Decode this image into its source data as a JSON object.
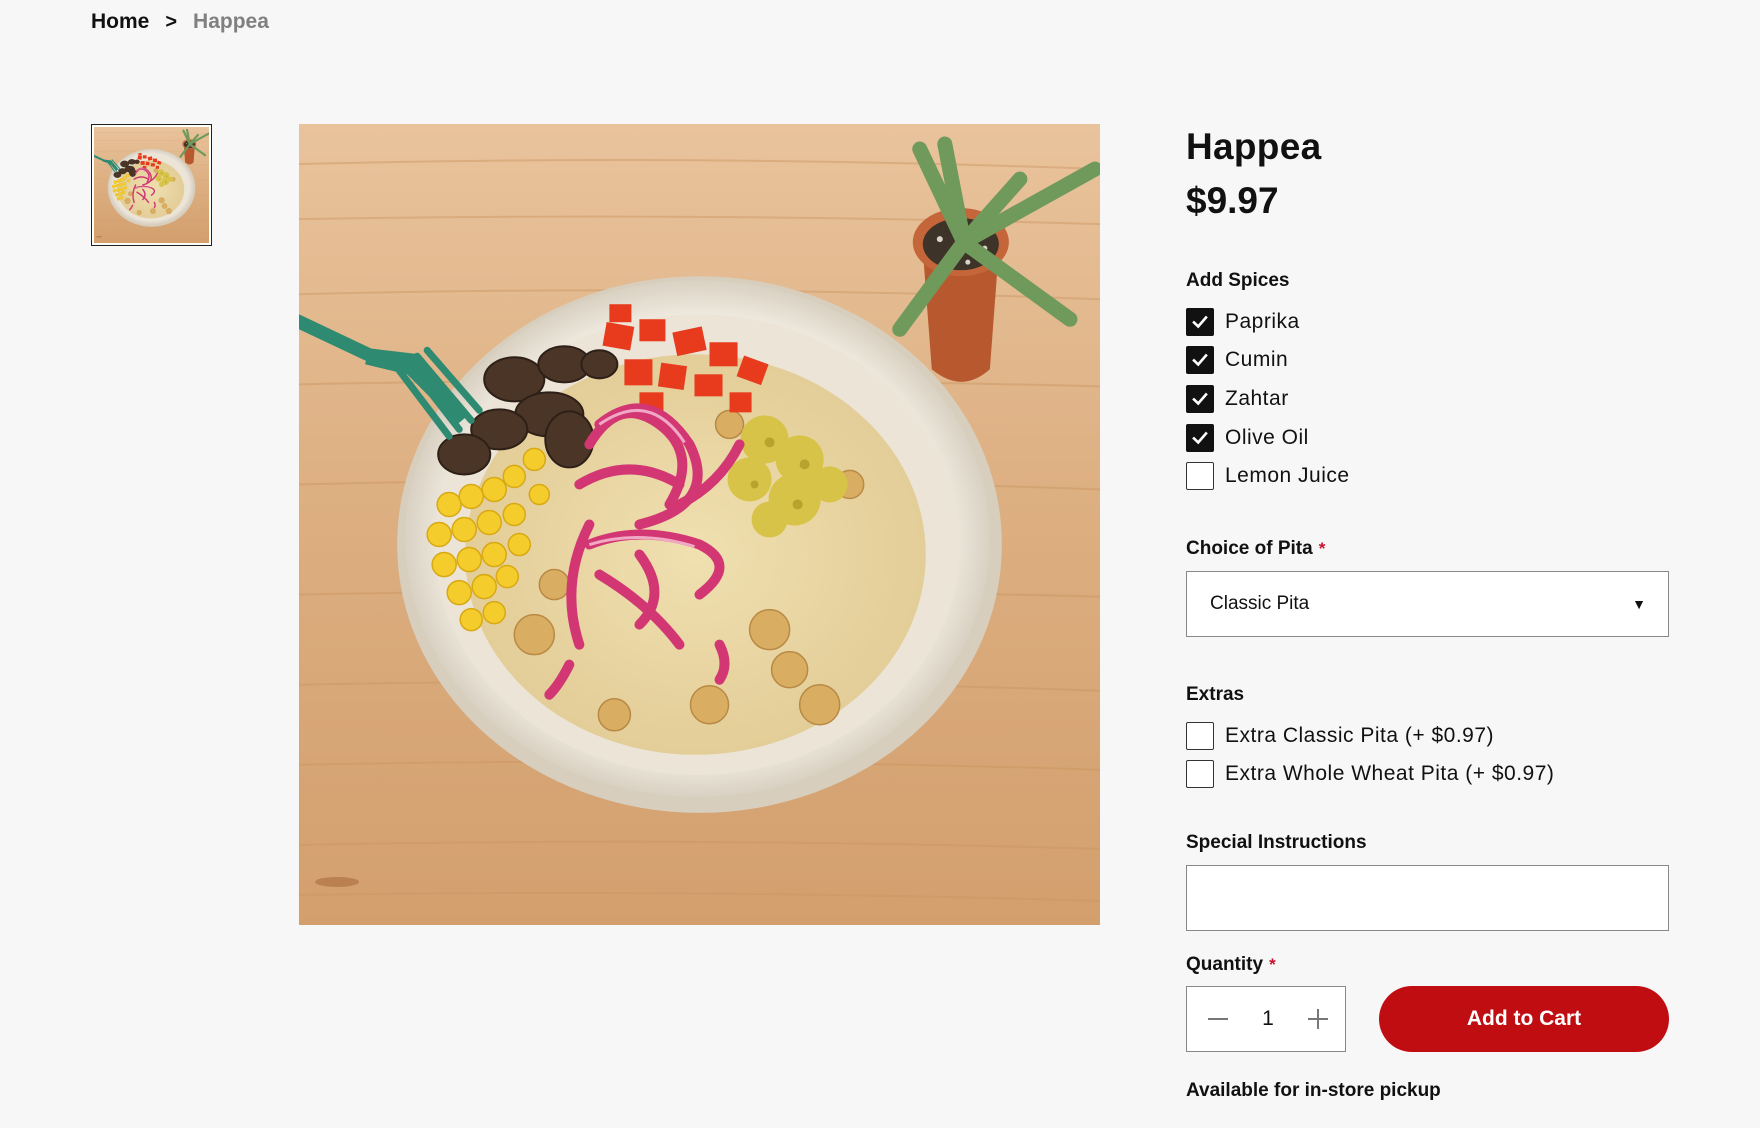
{
  "breadcrumb": {
    "home": "Home",
    "separator": ">",
    "current": "Happea"
  },
  "product": {
    "name": "Happea",
    "price": "$9.97",
    "image_subject": "hummus bowl with mushrooms, red peppers, corn, pickled onions, relish and chickpeas; green fork; potted succulent"
  },
  "spices": {
    "label": "Add Spices",
    "options": [
      {
        "label": "Paprika",
        "checked": true
      },
      {
        "label": "Cumin",
        "checked": true
      },
      {
        "label": "Zahtar",
        "checked": true
      },
      {
        "label": "Olive Oil",
        "checked": true
      },
      {
        "label": "Lemon Juice",
        "checked": false
      }
    ]
  },
  "pita": {
    "label": "Choice of Pita",
    "required_mark": "*",
    "selected": "Classic Pita"
  },
  "extras": {
    "label": "Extras",
    "options": [
      {
        "label": "Extra Classic Pita (+ $0.97)",
        "checked": false
      },
      {
        "label": "Extra Whole Wheat Pita (+ $0.97)",
        "checked": false
      }
    ]
  },
  "instructions": {
    "label": "Special Instructions",
    "value": ""
  },
  "quantity": {
    "label": "Quantity",
    "required_mark": "*",
    "value": "1"
  },
  "cart": {
    "button_label": "Add to Cart"
  },
  "pickup_note": "Available for in-store pickup",
  "colors": {
    "background": "#f7f7f7",
    "accent": "#c00d12",
    "required": "#c8102e",
    "muted": "#808080"
  },
  "icons": {
    "separator": "chevron-right-icon",
    "checkbox_checked": "check-icon",
    "select": "caret-down-icon",
    "decrement": "minus-icon",
    "increment": "plus-icon"
  }
}
